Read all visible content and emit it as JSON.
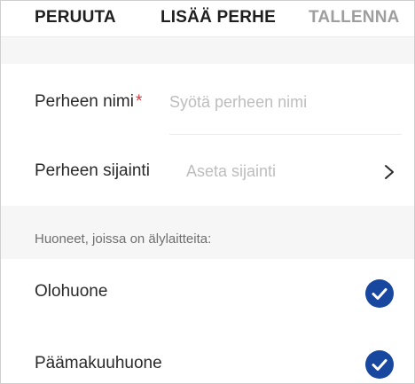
{
  "header": {
    "cancel_label": "PERUUTA",
    "title": "LISÄÄ PERHE",
    "save_label": "TALLENNA"
  },
  "form": {
    "family_name_label": "Perheen nimi",
    "required_marker": "*",
    "family_name_placeholder": "Syötä perheen nimi",
    "family_name_value": "",
    "location_label": "Perheen sijainti",
    "location_value": "Aseta sijainti"
  },
  "rooms": {
    "section_label": "Huoneet, joissa on älylaitteita:",
    "items": [
      {
        "label": "Olohuone",
        "checked": true
      },
      {
        "label": "Päämakuuhuone",
        "checked": true
      }
    ]
  },
  "colors": {
    "accent": "#17479e",
    "required": "#e0353b",
    "save_disabled": "#9e9e9e",
    "placeholder": "#bdbdbd",
    "section_bg": "#f6f6f6"
  },
  "icons": {
    "location_chevron": "chevron-right-icon",
    "room_check": "checkmark-circle-icon"
  }
}
